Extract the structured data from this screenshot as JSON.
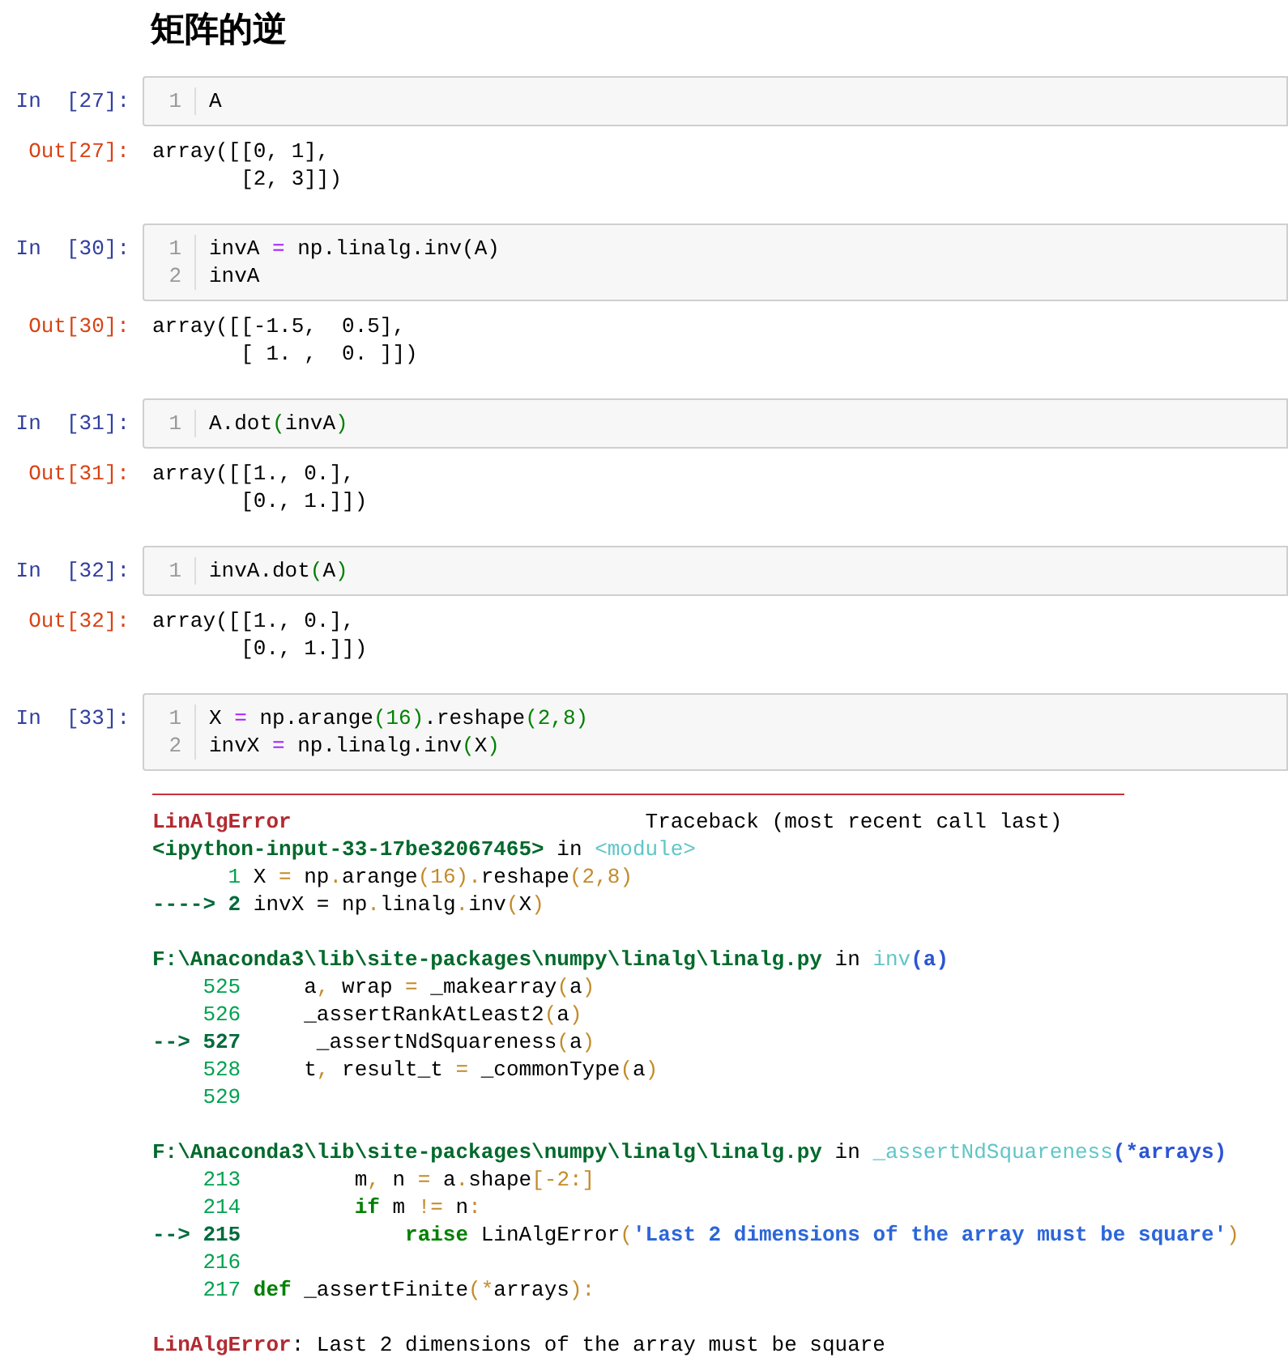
{
  "title": "矩阵的逆",
  "cells": [
    {
      "prompt": "In  [27]:",
      "lines": [
        {
          "number": "1",
          "tokens": [
            {
              "kind": "plain",
              "text": "A"
            }
          ]
        }
      ],
      "output": {
        "prompt": "Out[27]:",
        "lines": [
          "array([[0, 1],",
          "       [2, 3]])"
        ]
      }
    },
    {
      "prompt": "In  [30]:",
      "lines": [
        {
          "number": "1",
          "tokens": [
            {
              "kind": "plain",
              "text": "invA "
            },
            {
              "kind": "op",
              "text": "="
            },
            {
              "kind": "plain",
              "text": " np.linalg.inv(A)"
            }
          ]
        },
        {
          "number": "2",
          "tokens": [
            {
              "kind": "plain",
              "text": "invA"
            }
          ]
        }
      ],
      "output": {
        "prompt": "Out[30]:",
        "lines": [
          "array([[-1.5,  0.5],",
          "       [ 1. ,  0. ]])"
        ]
      }
    },
    {
      "prompt": "In  [31]:",
      "lines": [
        {
          "number": "1",
          "tokens": [
            {
              "kind": "plain",
              "text": "A.dot"
            },
            {
              "kind": "num",
              "text": "("
            },
            {
              "kind": "plain",
              "text": "invA"
            },
            {
              "kind": "num",
              "text": ")"
            }
          ]
        }
      ],
      "output": {
        "prompt": "Out[31]:",
        "lines": [
          "array([[1., 0.],",
          "       [0., 1.]])"
        ]
      }
    },
    {
      "prompt": "In  [32]:",
      "lines": [
        {
          "number": "1",
          "tokens": [
            {
              "kind": "plain",
              "text": "invA.dot"
            },
            {
              "kind": "num",
              "text": "("
            },
            {
              "kind": "plain",
              "text": "A"
            },
            {
              "kind": "num",
              "text": ")"
            }
          ]
        }
      ],
      "output": {
        "prompt": "Out[32]:",
        "lines": [
          "array([[1., 0.],",
          "       [0., 1.]])"
        ]
      }
    },
    {
      "prompt": "In  [33]:",
      "lines": [
        {
          "number": "1",
          "tokens": [
            {
              "kind": "plain",
              "text": "X "
            },
            {
              "kind": "op",
              "text": "="
            },
            {
              "kind": "plain",
              "text": " np.arange"
            },
            {
              "kind": "num",
              "text": "(16)"
            },
            {
              "kind": "plain",
              "text": ".reshape"
            },
            {
              "kind": "num",
              "text": "(2,8)"
            }
          ]
        },
        {
          "number": "2",
          "tokens": [
            {
              "kind": "plain",
              "text": "invX "
            },
            {
              "kind": "op",
              "text": "="
            },
            {
              "kind": "plain",
              "text": " np.linalg.inv"
            },
            {
              "kind": "num",
              "text": "("
            },
            {
              "kind": "plain",
              "text": "X"
            },
            {
              "kind": "num",
              "text": ")"
            }
          ]
        }
      ],
      "traceback": [
        [
          [
            {
              "kind": "err",
              "text": "LinAlgError"
            },
            {
              "kind": "plain",
              "text": "                            Traceback (most recent call last)"
            }
          ],
          [
            {
              "kind": "path",
              "text": "<ipython-input-33-17be32067465>"
            },
            {
              "kind": "plain",
              "text": " in "
            },
            {
              "kind": "fn",
              "text": "<module>"
            }
          ],
          [
            {
              "kind": "lineno",
              "text": "      1"
            },
            {
              "kind": "plain",
              "text": " X "
            },
            {
              "kind": "tbop",
              "text": "="
            },
            {
              "kind": "plain",
              "text": " np"
            },
            {
              "kind": "tbop",
              "text": "."
            },
            {
              "kind": "plain",
              "text": "arange"
            },
            {
              "kind": "tbop",
              "text": "(16)."
            },
            {
              "kind": "plain",
              "text": "reshape"
            },
            {
              "kind": "tbop",
              "text": "(2,8)"
            }
          ],
          [
            {
              "kind": "arrow",
              "text": "----> 2"
            },
            {
              "kind": "plain",
              "text": " invX = np"
            },
            {
              "kind": "tbop",
              "text": "."
            },
            {
              "kind": "plain",
              "text": "linalg"
            },
            {
              "kind": "tbop",
              "text": "."
            },
            {
              "kind": "plain",
              "text": "inv"
            },
            {
              "kind": "tbop",
              "text": "("
            },
            {
              "kind": "plain",
              "text": "X"
            },
            {
              "kind": "tbop",
              "text": ")"
            }
          ]
        ],
        [
          [
            {
              "kind": "path",
              "text": "F:\\Anaconda3\\lib\\site-packages\\numpy\\linalg\\linalg.py"
            },
            {
              "kind": "plain",
              "text": " in "
            },
            {
              "kind": "fn",
              "text": "inv"
            },
            {
              "kind": "arg",
              "text": "(a)"
            }
          ],
          [
            {
              "kind": "lineno",
              "text": "    525"
            },
            {
              "kind": "plain",
              "text": "     a"
            },
            {
              "kind": "tbop",
              "text": ","
            },
            {
              "kind": "plain",
              "text": " wrap "
            },
            {
              "kind": "tbop",
              "text": "="
            },
            {
              "kind": "plain",
              "text": " _makearray"
            },
            {
              "kind": "tbop",
              "text": "("
            },
            {
              "kind": "plain",
              "text": "a"
            },
            {
              "kind": "tbop",
              "text": ")"
            }
          ],
          [
            {
              "kind": "lineno",
              "text": "    526"
            },
            {
              "kind": "plain",
              "text": "     _assertRankAtLeast2"
            },
            {
              "kind": "tbop",
              "text": "("
            },
            {
              "kind": "plain",
              "text": "a"
            },
            {
              "kind": "tbop",
              "text": ")"
            }
          ],
          [
            {
              "kind": "arrow",
              "text": "--> 527"
            },
            {
              "kind": "plain",
              "text": "      _assertNdSquareness"
            },
            {
              "kind": "tbop",
              "text": "("
            },
            {
              "kind": "plain",
              "text": "a"
            },
            {
              "kind": "tbop",
              "text": ")"
            }
          ],
          [
            {
              "kind": "lineno",
              "text": "    528"
            },
            {
              "kind": "plain",
              "text": "     t"
            },
            {
              "kind": "tbop",
              "text": ","
            },
            {
              "kind": "plain",
              "text": " result_t "
            },
            {
              "kind": "tbop",
              "text": "="
            },
            {
              "kind": "plain",
              "text": " _commonType"
            },
            {
              "kind": "tbop",
              "text": "("
            },
            {
              "kind": "plain",
              "text": "a"
            },
            {
              "kind": "tbop",
              "text": ")"
            }
          ],
          [
            {
              "kind": "lineno",
              "text": "    529"
            }
          ]
        ],
        [
          [
            {
              "kind": "path",
              "text": "F:\\Anaconda3\\lib\\site-packages\\numpy\\linalg\\linalg.py"
            },
            {
              "kind": "plain",
              "text": " in "
            },
            {
              "kind": "fn",
              "text": "_assertNdSquareness"
            },
            {
              "kind": "arg",
              "text": "(*arrays)"
            }
          ],
          [
            {
              "kind": "lineno",
              "text": "    213"
            },
            {
              "kind": "plain",
              "text": "         m"
            },
            {
              "kind": "tbop",
              "text": ","
            },
            {
              "kind": "plain",
              "text": " n "
            },
            {
              "kind": "tbop",
              "text": "="
            },
            {
              "kind": "plain",
              "text": " a"
            },
            {
              "kind": "tbop",
              "text": "."
            },
            {
              "kind": "plain",
              "text": "shape"
            },
            {
              "kind": "tbop",
              "text": "[-2:]"
            }
          ],
          [
            {
              "kind": "lineno",
              "text": "    214"
            },
            {
              "kind": "kw",
              "text": "         if"
            },
            {
              "kind": "plain",
              "text": " m "
            },
            {
              "kind": "tbop",
              "text": "!="
            },
            {
              "kind": "plain",
              "text": " n"
            },
            {
              "kind": "tbop",
              "text": ":"
            }
          ],
          [
            {
              "kind": "arrow",
              "text": "--> 215"
            },
            {
              "kind": "kw",
              "text": "             raise"
            },
            {
              "kind": "plain",
              "text": " LinAlgError"
            },
            {
              "kind": "tbop",
              "text": "("
            },
            {
              "kind": "str",
              "text": "'Last 2 dimensions of the array must be square'"
            },
            {
              "kind": "tbop",
              "text": ")"
            }
          ],
          [
            {
              "kind": "lineno",
              "text": "    216"
            }
          ],
          [
            {
              "kind": "lineno",
              "text": "    217"
            },
            {
              "kind": "kw",
              "text": " def"
            },
            {
              "kind": "plain",
              "text": " _assertFinite"
            },
            {
              "kind": "tbop",
              "text": "(*"
            },
            {
              "kind": "plain",
              "text": "arrays"
            },
            {
              "kind": "tbop",
              "text": "):"
            }
          ]
        ],
        [
          [
            {
              "kind": "err",
              "text": "LinAlgError"
            },
            {
              "kind": "plain",
              "text": ": Last 2 dimensions of the array must be square"
            }
          ]
        ]
      ]
    }
  ]
}
